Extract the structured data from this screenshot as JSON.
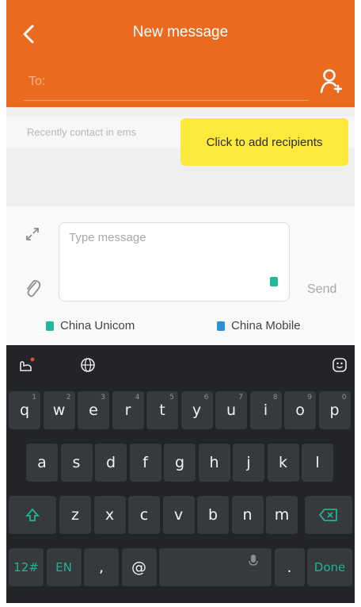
{
  "header": {
    "title": "New message",
    "to_label": "To:"
  },
  "suggestions": {
    "recent_text": "Recently contact in ems",
    "tooltip": "Click to add recipients"
  },
  "compose": {
    "placeholder": "Type message",
    "send_label": "Send"
  },
  "sims": [
    {
      "label": "China Unicom",
      "color": "#24b89a"
    },
    {
      "label": "China Mobile",
      "color": "#2f8fd6"
    }
  ],
  "keyboard": {
    "row1": [
      {
        "k": "q",
        "h": "1"
      },
      {
        "k": "w",
        "h": "2"
      },
      {
        "k": "e",
        "h": "3"
      },
      {
        "k": "r",
        "h": "4"
      },
      {
        "k": "t",
        "h": "5"
      },
      {
        "k": "y",
        "h": "6"
      },
      {
        "k": "u",
        "h": "7"
      },
      {
        "k": "i",
        "h": "8"
      },
      {
        "k": "o",
        "h": "9"
      },
      {
        "k": "p",
        "h": "0"
      }
    ],
    "row2": [
      {
        "k": "a",
        "h": ""
      },
      {
        "k": "s",
        "h": ""
      },
      {
        "k": "d",
        "h": ""
      },
      {
        "k": "f",
        "h": ""
      },
      {
        "k": "g",
        "h": ""
      },
      {
        "k": "h",
        "h": ""
      },
      {
        "k": "j",
        "h": ""
      },
      {
        "k": "k",
        "h": ""
      },
      {
        "k": "l",
        "h": ""
      }
    ],
    "row3": [
      {
        "k": "z",
        "h": ""
      },
      {
        "k": "x",
        "h": ""
      },
      {
        "k": "c",
        "h": ""
      },
      {
        "k": "v",
        "h": ""
      },
      {
        "k": "b",
        "h": ""
      },
      {
        "k": "n",
        "h": ""
      },
      {
        "k": "m",
        "h": ""
      }
    ],
    "num_label": "12#",
    "lang_label": "EN",
    "comma_label": ",",
    "at_label": "@",
    "period_label": ".",
    "done_label": "Done"
  },
  "colors": {
    "accent": "#ea6a1e",
    "tooltip": "#fde93b",
    "keyboard_bg": "#222428",
    "key_bg": "#363a3f",
    "key_func": "#1fb58a"
  }
}
